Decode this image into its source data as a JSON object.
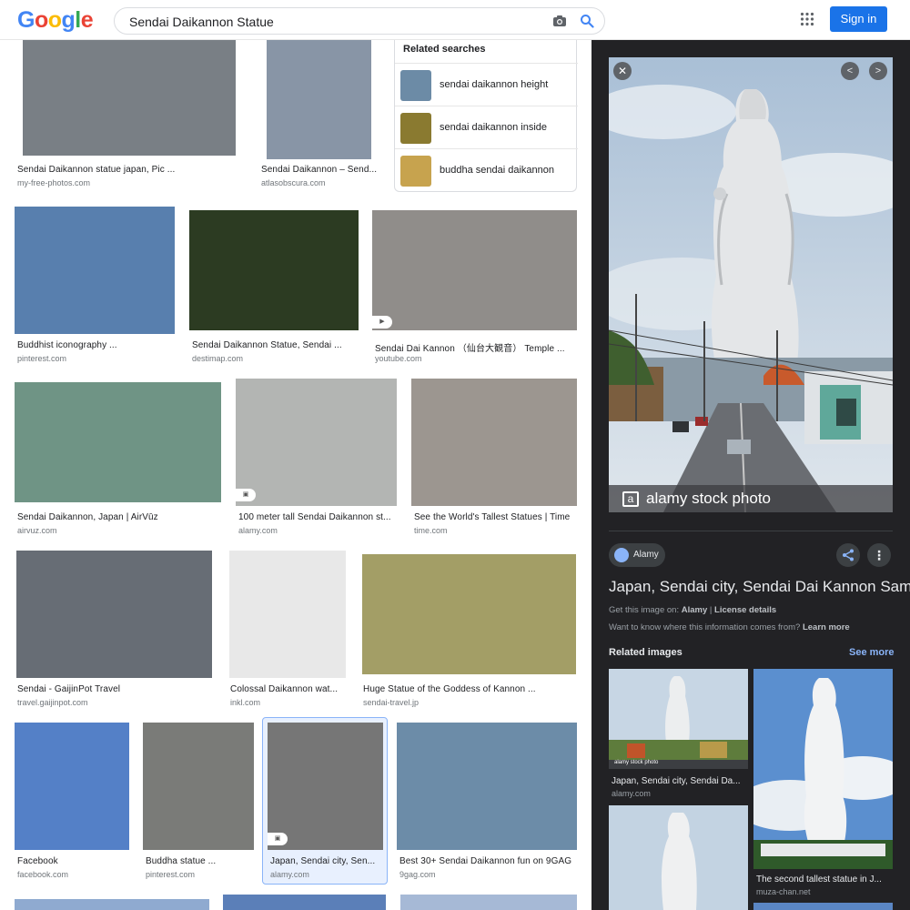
{
  "header": {
    "logo_letters": [
      "G",
      "o",
      "o",
      "g",
      "l",
      "e"
    ],
    "logo_colors": [
      "#4285f4",
      "#ea4335",
      "#fbbc05",
      "#4285f4",
      "#34a853",
      "#ea4335"
    ],
    "search_value": "Sendai Daikannon Statue",
    "sign_in_label": "Sign in"
  },
  "results": [
    {
      "title": "Sendai Daikannon statue japan, Pic ...",
      "source": "my-free-photos.com",
      "color": "#797f85"
    },
    {
      "title": "Sendai Daikannon – Send...",
      "source": "atlasobscura.com",
      "color": "#8895a6"
    },
    {
      "title": "Buddhist iconography ...",
      "source": "pinterest.com",
      "color": "#587fae"
    },
    {
      "title": "Sendai Daikannon Statue, Sendai ...",
      "source": "destimap.com",
      "color": "#2c3b22"
    },
    {
      "title": "Sendai Dai Kannon （仙台大観音） Temple ...",
      "source": "youtube.com",
      "color": "#908d8a"
    },
    {
      "title": "Sendai Daikannon, Japan | AirVūz",
      "source": "airvuz.com",
      "color": "#6f9485"
    },
    {
      "title": "100 meter tall Sendai Daikannon st...",
      "source": "alamy.com",
      "color": "#b3b5b3"
    },
    {
      "title": "See the World's Tallest Statues | Time",
      "source": "time.com",
      "color": "#9c9690"
    },
    {
      "title": "Sendai - GaijinPot Travel",
      "source": "travel.gaijinpot.com",
      "color": "#676d75"
    },
    {
      "title": "Colossal Daikannon wat...",
      "source": "inkl.com",
      "color": "#e8e8e8"
    },
    {
      "title": "Huge Statue of the Goddess of Kannon ...",
      "source": "sendai-travel.jp",
      "color": "#a39e66"
    },
    {
      "title": "Facebook",
      "source": "facebook.com",
      "color": "#5480c7"
    },
    {
      "title": "Buddha statue ...",
      "source": "pinterest.com",
      "color": "#7a7b78"
    },
    {
      "title": "Japan, Sendai city, Sen...",
      "source": "alamy.com",
      "color": "#767676"
    },
    {
      "title": "Best 30+ Sendai Daikannon fun on 9GAG",
      "source": "9gag.com",
      "color": "#6c8ca8"
    },
    {
      "title": "",
      "source": "",
      "color": "#8faad0"
    },
    {
      "title": "",
      "source": "",
      "color": "#5b7fb8"
    },
    {
      "title": "",
      "source": "",
      "color": "#a6b9d6"
    }
  ],
  "badges": {
    "video": "▶",
    "image": "▣"
  },
  "related_searches": {
    "heading": "Related searches",
    "items": [
      {
        "label": "sendai daikannon height",
        "color": "#6c8ba6"
      },
      {
        "label": "sendai daikannon inside",
        "color": "#8a7a30"
      },
      {
        "label": "buddha sendai daikannon",
        "color": "#c7a34e"
      }
    ]
  },
  "panel": {
    "watermark": "alamy stock photo",
    "watermark_mark": "a",
    "source_chip": "Alamy",
    "title": "Japan, Sendai city, Sendai Dai Kannon Sama",
    "get_prefix": "Get this image on:",
    "get_source": "Alamy",
    "get_sep": "|",
    "get_license": "License details",
    "want_text": "Want to know where this information comes from?",
    "learn_more": "Learn more",
    "related_heading": "Related images",
    "see_more": "See more",
    "related_images": [
      {
        "title": "Japan, Sendai city, Sendai Da...",
        "source": "alamy.com",
        "color": "#b8c9d8",
        "watermark": "alamy stock photo"
      },
      {
        "title": "The second tallest statue in J...",
        "source": "muza-chan.net",
        "color": "#6f9fd6"
      },
      {
        "title": "",
        "source": "",
        "color": "#c3d2e0"
      },
      {
        "title": "",
        "source": "",
        "color": "#5a86c4"
      }
    ]
  }
}
